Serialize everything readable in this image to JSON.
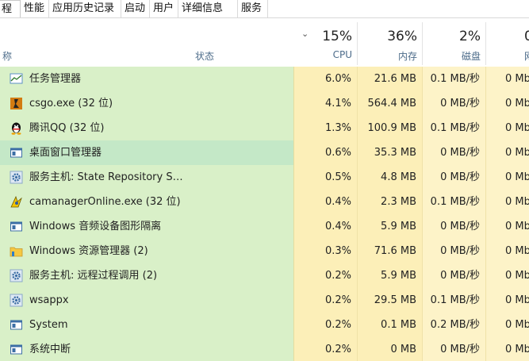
{
  "tabs": [
    {
      "label": "进程",
      "visible": "程",
      "active": true
    },
    {
      "label": "性能"
    },
    {
      "label": "应用历史记录"
    },
    {
      "label": "启动"
    },
    {
      "label": "用户"
    },
    {
      "label": "详细信息"
    },
    {
      "label": "服务"
    }
  ],
  "header": {
    "name_col": "称",
    "status_col": "状态",
    "cpu": {
      "percent": "15%",
      "label": "CPU"
    },
    "memory": {
      "percent": "36%",
      "label": "内存"
    },
    "disk": {
      "percent": "2%",
      "label": "磁盘"
    },
    "network": {
      "percent": "0",
      "label": "网"
    }
  },
  "rows": [
    {
      "icon": "task-manager-icon",
      "name": "任务管理器",
      "cpu": "6.0%",
      "mem": "21.6 MB",
      "disk": "0.1 MB/秒",
      "net": "0 Mb"
    },
    {
      "icon": "csgo-icon",
      "name": "csgo.exe (32 位)",
      "cpu": "4.1%",
      "mem": "564.4 MB",
      "disk": "0 MB/秒",
      "net": "0 Mb"
    },
    {
      "icon": "qq-penguin-icon",
      "name": "腾讯QQ (32 位)",
      "cpu": "1.3%",
      "mem": "100.9 MB",
      "disk": "0.1 MB/秒",
      "net": "0 Mb"
    },
    {
      "icon": "window-app-icon",
      "name": "桌面窗口管理器",
      "cpu": "0.6%",
      "mem": "35.3 MB",
      "disk": "0 MB/秒",
      "net": "0 Mb",
      "selected": true
    },
    {
      "icon": "gear-service-icon",
      "name": "服务主机: State Repository Se...",
      "cpu": "0.5%",
      "mem": "4.8 MB",
      "disk": "0 MB/秒",
      "net": "0 Mb"
    },
    {
      "icon": "camanager-icon",
      "name": "camanagerOnline.exe (32 位)",
      "cpu": "0.4%",
      "mem": "2.3 MB",
      "disk": "0.1 MB/秒",
      "net": "0 Mb"
    },
    {
      "icon": "window-app-icon",
      "name": "Windows 音频设备图形隔离",
      "cpu": "0.4%",
      "mem": "5.9 MB",
      "disk": "0 MB/秒",
      "net": "0 Mb"
    },
    {
      "icon": "folder-explorer-icon",
      "name": "Windows 资源管理器 (2)",
      "cpu": "0.3%",
      "mem": "71.6 MB",
      "disk": "0 MB/秒",
      "net": "0 Mb"
    },
    {
      "icon": "gear-service-icon",
      "name": "服务主机: 远程过程调用 (2)",
      "cpu": "0.2%",
      "mem": "5.9 MB",
      "disk": "0 MB/秒",
      "net": "0 Mb"
    },
    {
      "icon": "gear-service-icon",
      "name": "wsappx",
      "cpu": "0.2%",
      "mem": "29.5 MB",
      "disk": "0.1 MB/秒",
      "net": "0 Mb"
    },
    {
      "icon": "window-app-icon",
      "name": "System",
      "cpu": "0.2%",
      "mem": "0.1 MB",
      "disk": "0.2 MB/秒",
      "net": "0 Mb"
    },
    {
      "icon": "window-app-icon",
      "name": "系统中断",
      "cpu": "0.2%",
      "mem": "0 MB",
      "disk": "0 MB/秒",
      "net": "0 Mb"
    }
  ],
  "colors": {
    "heat_strong": "#fcefb8",
    "heat_light": "#fdf3c8",
    "name_bg": "#d9f0c8",
    "selected_bg": "#c4e8c7"
  }
}
